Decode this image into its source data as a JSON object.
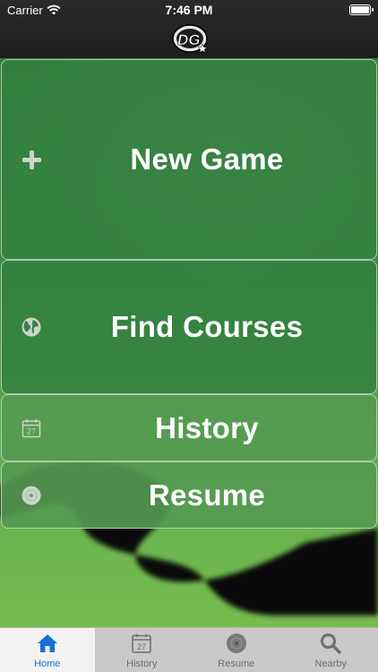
{
  "status_bar": {
    "carrier": "Carrier",
    "time": "7:46 PM"
  },
  "header": {
    "logo_text": "DG"
  },
  "menu": {
    "new_game": {
      "label": "New Game",
      "icon": "plus-icon"
    },
    "find_courses": {
      "label": "Find Courses",
      "icon": "globe-icon"
    },
    "history": {
      "label": "History",
      "icon": "calendar-icon",
      "calendar_day": "27"
    },
    "resume": {
      "label": "Resume",
      "icon": "disc-icon"
    }
  },
  "tabs": [
    {
      "label": "Home",
      "icon": "home-icon",
      "active": true
    },
    {
      "label": "History",
      "icon": "calendar-icon",
      "calendar_day": "27",
      "active": false
    },
    {
      "label": "Resume",
      "icon": "disc-icon",
      "active": false
    },
    {
      "label": "Nearby",
      "icon": "search-icon",
      "active": false
    }
  ],
  "colors": {
    "accent": "#1a6fd6",
    "button_green": "#348040",
    "tab_bar": "#c9c9c9"
  }
}
